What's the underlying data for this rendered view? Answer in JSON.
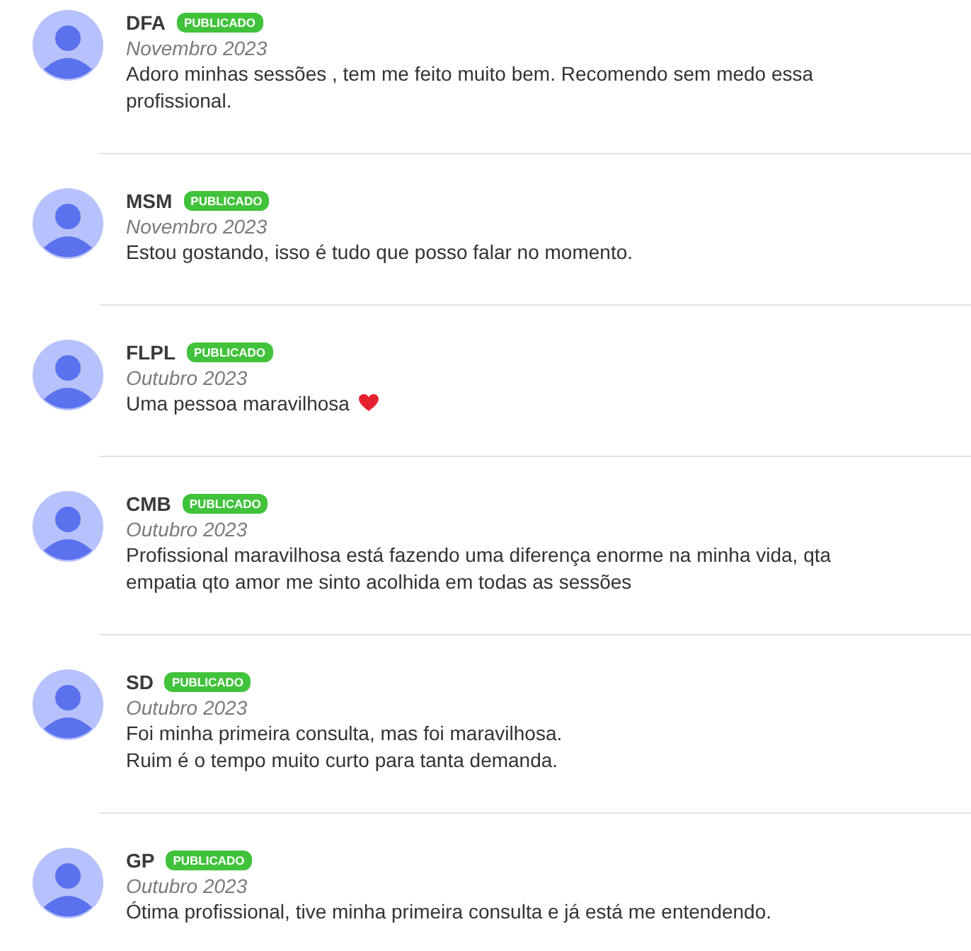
{
  "reviews": [
    {
      "name": "DFA",
      "status": "PUBLICADO",
      "date": "Novembro 2023",
      "lines": [
        "Adoro minhas sessões , tem me feito muito bem. Recomendo sem medo essa profissional."
      ],
      "heart": false
    },
    {
      "name": "MSM",
      "status": "PUBLICADO",
      "date": "Novembro 2023",
      "lines": [
        "Estou gostando,  isso é tudo que posso falar no momento."
      ],
      "heart": false
    },
    {
      "name": "FLPL",
      "status": "PUBLICADO",
      "date": "Outubro 2023",
      "lines": [
        "Uma pessoa maravilhosa"
      ],
      "heart": true
    },
    {
      "name": "CMB",
      "status": "PUBLICADO",
      "date": "Outubro 2023",
      "lines": [
        "Profissional maravilhosa está fazendo uma diferença enorme na minha vida, qta empatia qto amor me sinto acolhida em todas as sessões"
      ],
      "heart": false
    },
    {
      "name": "SD",
      "status": "PUBLICADO",
      "date": "Outubro 2023",
      "lines": [
        "Foi minha primeira consulta, mas foi maravilhosa.",
        "Ruim é o tempo muito curto para tanta demanda."
      ],
      "heart": false
    },
    {
      "name": "GP",
      "status": "PUBLICADO",
      "date": "Outubro 2023",
      "lines": [
        "Ótima profissional, tive minha primeira consulta e já está me entendendo."
      ],
      "heart": false
    }
  ]
}
